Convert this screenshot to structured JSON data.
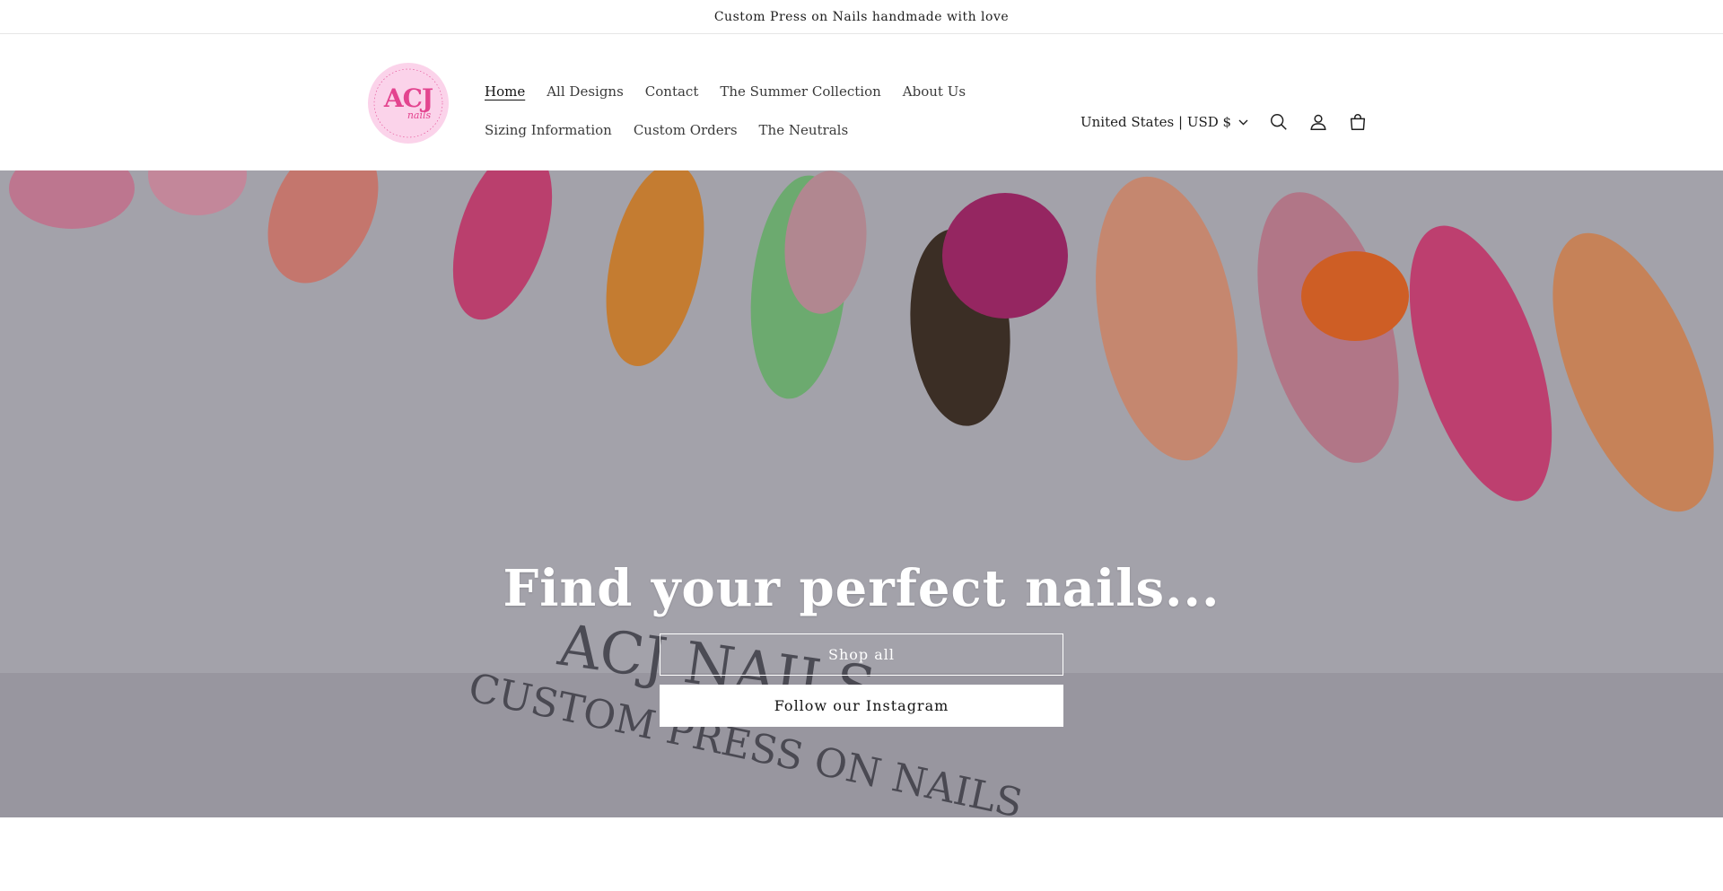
{
  "announcement": {
    "text": "Custom Press on Nails handmade with love"
  },
  "logo": {
    "mark": "ACJ",
    "script": "nails"
  },
  "nav": {
    "row1": [
      "Home",
      "All Designs",
      "Contact",
      "The Summer Collection",
      "About Us"
    ],
    "row2": [
      "Sizing Information",
      "Custom Orders",
      "The Neutrals"
    ],
    "active": "Home"
  },
  "header_right": {
    "locale": "United States | USD $",
    "icons": [
      "search-icon",
      "account-icon",
      "cart-icon"
    ]
  },
  "hero": {
    "title": "Find your perfect nails...",
    "buttons": {
      "shop_all": "Shop all",
      "instagram": "Follow our Instagram"
    },
    "backdrop_text": {
      "brand": "ACJ NAILS",
      "tagline": "CUSTOM PRESS ON NAILS"
    }
  },
  "colors": {
    "logo_bg": "#fbd3ea",
    "logo_text": "#e3448f",
    "hero_title": "#ffffff",
    "text": "#121212"
  }
}
